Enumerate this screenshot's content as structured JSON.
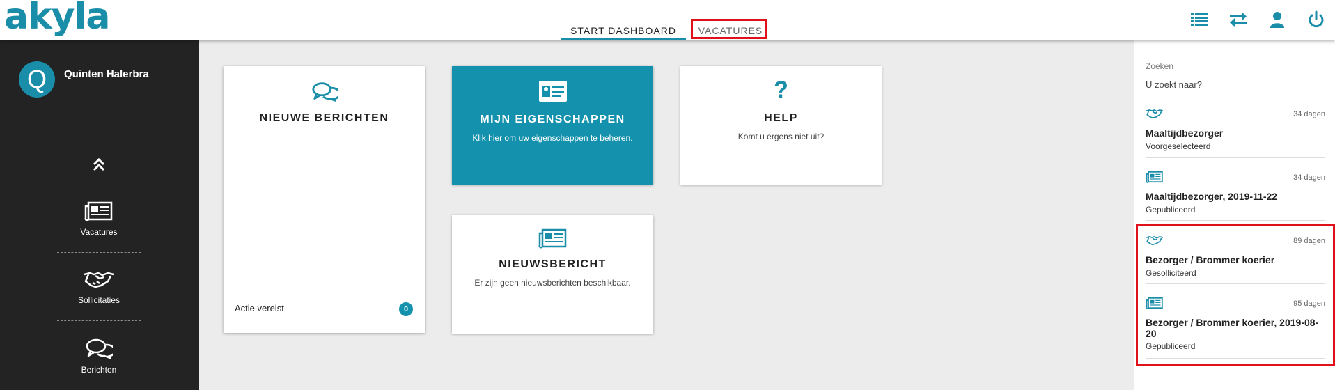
{
  "brand": {
    "logo_text": "akyla"
  },
  "header": {
    "tabs": [
      {
        "label": "START DASHBOARD",
        "active": true
      },
      {
        "label": "VACATURES",
        "active": false,
        "highlighted": true
      }
    ],
    "icons": [
      "list-icon",
      "swap-arrows-icon",
      "user-icon",
      "power-icon"
    ]
  },
  "sidebar": {
    "user": {
      "initial": "Q",
      "name": "Quinten Halerbra"
    },
    "collapse_icon": "chevron-double-up-icon",
    "items": [
      {
        "label": "Vacatures",
        "icon": "newspaper-icon"
      },
      {
        "label": "Sollicitaties",
        "icon": "handshake-icon"
      },
      {
        "label": "Berichten",
        "icon": "chat-bubbles-icon"
      }
    ]
  },
  "cards": {
    "nieuwe_berichten": {
      "title": "NIEUWE BERICHTEN",
      "footer_label": "Actie vereist",
      "badge": "0",
      "icon": "chat-bubbles-icon"
    },
    "mijn_eigenschappen": {
      "title": "MIJN EIGENSCHAPPEN",
      "subtitle": "Klik hier om uw eigenschappen te beheren.",
      "icon": "id-card-icon"
    },
    "help": {
      "title": "HELP",
      "subtitle": "Komt u ergens niet uit?",
      "icon": "question-icon"
    },
    "nieuwsbericht": {
      "title": "NIEUWSBERICHT",
      "subtitle": "Er zijn geen nieuwsberichten beschikbaar.",
      "icon": "newspaper-icon"
    }
  },
  "right_panel": {
    "search": {
      "label": "Zoeken",
      "placeholder": "U zoekt naar?"
    },
    "items": [
      {
        "icon": "handshake-icon",
        "days": "34 dagen",
        "title": "Maaltijdbezorger",
        "status": "Voorgeselecteerd"
      },
      {
        "icon": "newspaper-icon",
        "days": "34 dagen",
        "title": "Maaltijdbezorger, 2019-11-22",
        "status": "Gepubliceerd"
      },
      {
        "icon": "handshake-icon",
        "days": "89 dagen",
        "title": "Bezorger / Brommer koerier",
        "status": "Gesolliciteerd"
      },
      {
        "icon": "newspaper-icon",
        "days": "95 dagen",
        "title": "Bezorger / Brommer koerier, 2019-08-20",
        "status": "Gepubliceerd"
      }
    ]
  },
  "colors": {
    "accent": "#1a8da8",
    "card_teal": "#1491ac",
    "sidebar": "#232323",
    "highlight": "#e0111b"
  }
}
